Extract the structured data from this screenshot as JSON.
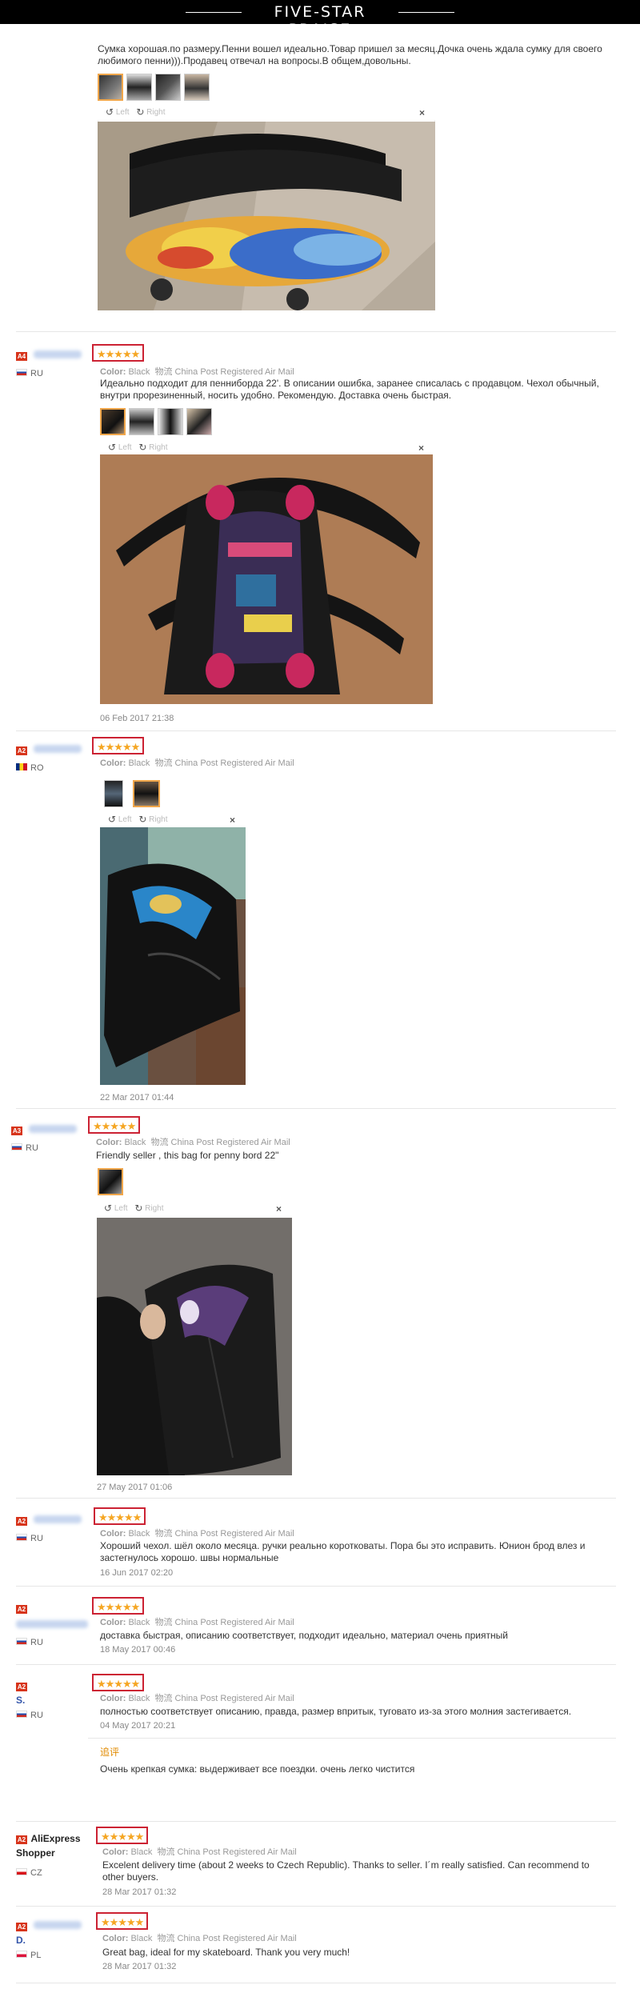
{
  "banner": {
    "title": "FIVE-STAR PRAISE"
  },
  "stars": "★★★★★",
  "close_icon": "×",
  "viewer": {
    "left_label": "Left",
    "right_label": "Right",
    "rotate_left_icon": "↺",
    "rotate_right_icon": "↻"
  },
  "reviews": [
    {
      "text": "Сумка хорошая.по размеру.Пенни вошел идеально.Товар пришел за месяц.Дочка очень ждала сумку для своего любимого пенни))).Продавец отвечал на вопросы.В общем,довольны."
    },
    {
      "level": "A4",
      "country": "RU",
      "color_label": "Color:",
      "color_value": "Black",
      "shipping": "物流 China Post Registered Air Mail",
      "text": "Идеально подходит для пенниборда 22'. В описании ошибка, заранее списалась с продавцом. Чехол обычный, внутри прорезиненный, носить удобно. Рекомендую. Доставка очень быстрая.",
      "date": "06 Feb 2017 21:38"
    },
    {
      "level": "A2",
      "country": "RO",
      "color_label": "Color:",
      "color_value": "Black",
      "shipping": "物流 China Post Registered Air Mail",
      "date": "22 Mar 2017 01:44"
    },
    {
      "level": "A3",
      "country": "RU",
      "color_label": "Color:",
      "color_value": "Black",
      "shipping": "物流 China Post Registered Air Mail",
      "text": "Friendly seller , this bag for penny bord 22\"",
      "date": "27 May 2017 01:06"
    },
    {
      "level": "A2",
      "country": "RU",
      "color_label": "Color:",
      "color_value": "Black",
      "shipping": "物流 China Post Registered Air Mail",
      "text": "Хороший чехол. шёл около месяца. ручки реально коротковаты. Пора бы это исправить. Юнион брод влез и застегнулось хорошо. швы нормальные",
      "date": "16 Jun 2017 02:20"
    },
    {
      "level": "A2",
      "country": "RU",
      "color_label": "Color:",
      "color_value": "Black",
      "shipping": "物流 China Post Registered Air Mail",
      "text": "доставка быстрая, описанию соответствует, подходит идеально, материал очень приятный",
      "date": "18 May 2017 00:46"
    },
    {
      "level": "A2",
      "name": "S.",
      "country": "RU",
      "color_label": "Color:",
      "color_value": "Black",
      "shipping": "物流 China Post Registered Air Mail",
      "text": "полностью соответствует описанию, правда, размер впритык, туговато из-за этого молния застегивается.",
      "date": "04 May 2017 20:21",
      "additional_label": "追评",
      "additional_text": "Очень крепкая сумка: выдерживает все поездки. очень легко чистится"
    },
    {
      "level": "A2",
      "name": "AliExpress Shopper",
      "country": "CZ",
      "color_label": "Color:",
      "color_value": "Black",
      "shipping": "物流 China Post Registered Air Mail",
      "text": "Excelent delivery time (about 2 weeks to Czech Republic). Thanks to seller. I´m really satisfied. Can recommend to other buyers.",
      "date": "28 Mar 2017 01:32"
    },
    {
      "level": "A2",
      "name": "D.",
      "country": "PL",
      "color_label": "Color:",
      "color_value": "Black",
      "shipping": "物流 China Post Registered Air Mail",
      "text": "Great bag, ideal for my skateboard. Thank you very much!",
      "date": "28 Mar 2017 01:32"
    }
  ]
}
